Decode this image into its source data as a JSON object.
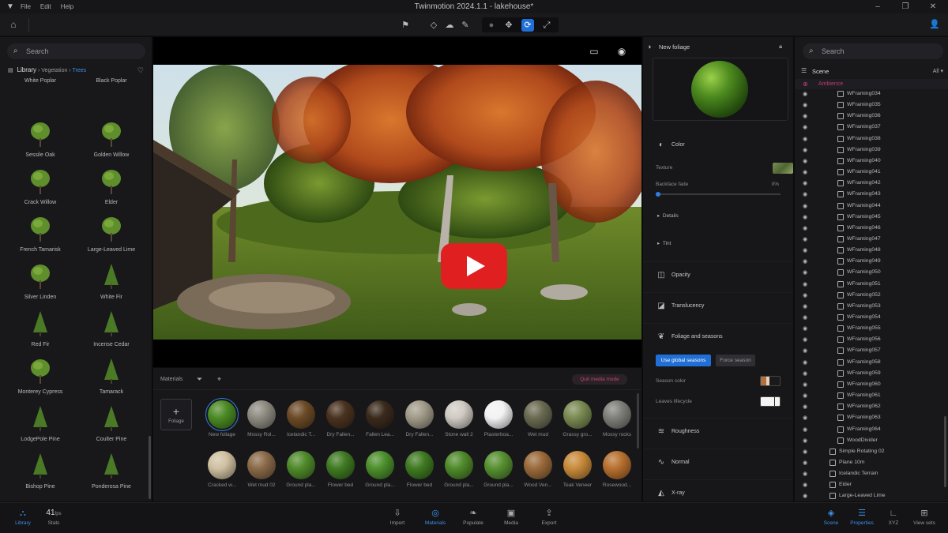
{
  "window": {
    "title": "Twinmotion 2024.1.1 - lakehouse*",
    "menu": [
      "File",
      "Edit",
      "Help"
    ]
  },
  "library": {
    "search_placeholder": "Search",
    "breadcrumb": {
      "root": "Library",
      "level1": "Vegetation",
      "current": "Trees"
    },
    "items": [
      "White Poplar",
      "Black Poplar",
      "Sessile Oak",
      "Golden Willow",
      "Crack Willow",
      "Elder",
      "French Tamarisk",
      "Large-Leaved Lime",
      "Silver Linden",
      "White Fir",
      "Red Fir",
      "Incense Cedar",
      "Monterey Cypress",
      "Tamarack",
      "LodgePole Pine",
      "Coulter Pine",
      "Bishop Pine",
      "Ponderosa Pine"
    ]
  },
  "materials": {
    "title": "Materials",
    "exit_button": "Quit media mode",
    "new_label": "Foliage",
    "row1": [
      "New foliage",
      "Mossy Rol...",
      "Icelandic T...",
      "Dry Fallen...",
      "Fallen Lea...",
      "Dry Fallen...",
      "Stone wall 2",
      "Plasterboa...",
      "Wet mud",
      "Grassy gro...",
      "Mossy rocks"
    ],
    "row2": [
      "Cracked w...",
      "Wet mud 02",
      "Ground pla...",
      "Flower bed",
      "Ground pla...",
      "Flower bed",
      "Ground pla...",
      "Ground pla...",
      "Wood Ven...",
      "Teak Veneer",
      "Rosewood..."
    ],
    "colors_row1": [
      "#4b8a24",
      "#8d8a80",
      "#6b4a26",
      "#4a3220",
      "#3a2a1c",
      "#a09a88",
      "#cfcac2",
      "#f2f2f2",
      "#6a6a52",
      "#7a8a52",
      "#7f7f7a"
    ],
    "colors_row2": [
      "#cfc0a0",
      "#8a6a48",
      "#4f8a2a",
      "#3f7a22",
      "#4c8f2c",
      "#3f7a22",
      "#4f8a2a",
      "#569030",
      "#9a6a3a",
      "#c88a3a",
      "#b8702f"
    ]
  },
  "properties": {
    "title": "New foliage",
    "color_section": "Color",
    "texture_label": "Texture",
    "backface_label": "Backface fade",
    "backface_value": "0%",
    "backface_level": 0,
    "details_label": "Details",
    "tint_label": "Tint",
    "opacity_section": "Opacity",
    "translucency_section": "Translucency",
    "foliage_section": "Foliage and seasons",
    "global_seasons_button": "Use global seasons",
    "force_season_button": "Force season",
    "season_color_label": "Season color",
    "leaves_lifecycle_label": "Leaves lifecycle",
    "roughness_section": "Roughness",
    "normal_section": "Normal",
    "xray_section": "X-ray"
  },
  "scene": {
    "search_placeholder": "Search",
    "title": "Scene",
    "filter": "All",
    "ambience": "Ambience",
    "items": [
      "WFraming034",
      "WFraming035",
      "WFraming036",
      "WFraming037",
      "WFraming038",
      "WFraming039",
      "WFraming040",
      "WFraming041",
      "WFraming042",
      "WFraming043",
      "WFraming044",
      "WFraming045",
      "WFraming046",
      "WFraming047",
      "WFraming048",
      "WFraming049",
      "WFraming050",
      "WFraming051",
      "WFraming052",
      "WFraming053",
      "WFraming054",
      "WFraming055",
      "WFraming056",
      "WFraming057",
      "WFraming058",
      "WFraming059",
      "WFraming060",
      "WFraming061",
      "WFraming062",
      "WFraming063",
      "WFraming064",
      "WoodDivider",
      "Simple Rotating 02",
      "Plane 10m",
      "Icelandic Terrain",
      "Elder",
      "Large-Leaved Lime"
    ]
  },
  "bottom": {
    "library": "Library",
    "stats_value": "41",
    "stats_unit": "fps",
    "stats": "Stats",
    "import": "Import",
    "materials": "Materials",
    "populate": "Populate",
    "media": "Media",
    "export": "Export",
    "scene": "Scene",
    "properties": "Properties",
    "xyz": "XYZ",
    "viewsets": "View sets"
  },
  "accent": "#2f7fe0"
}
